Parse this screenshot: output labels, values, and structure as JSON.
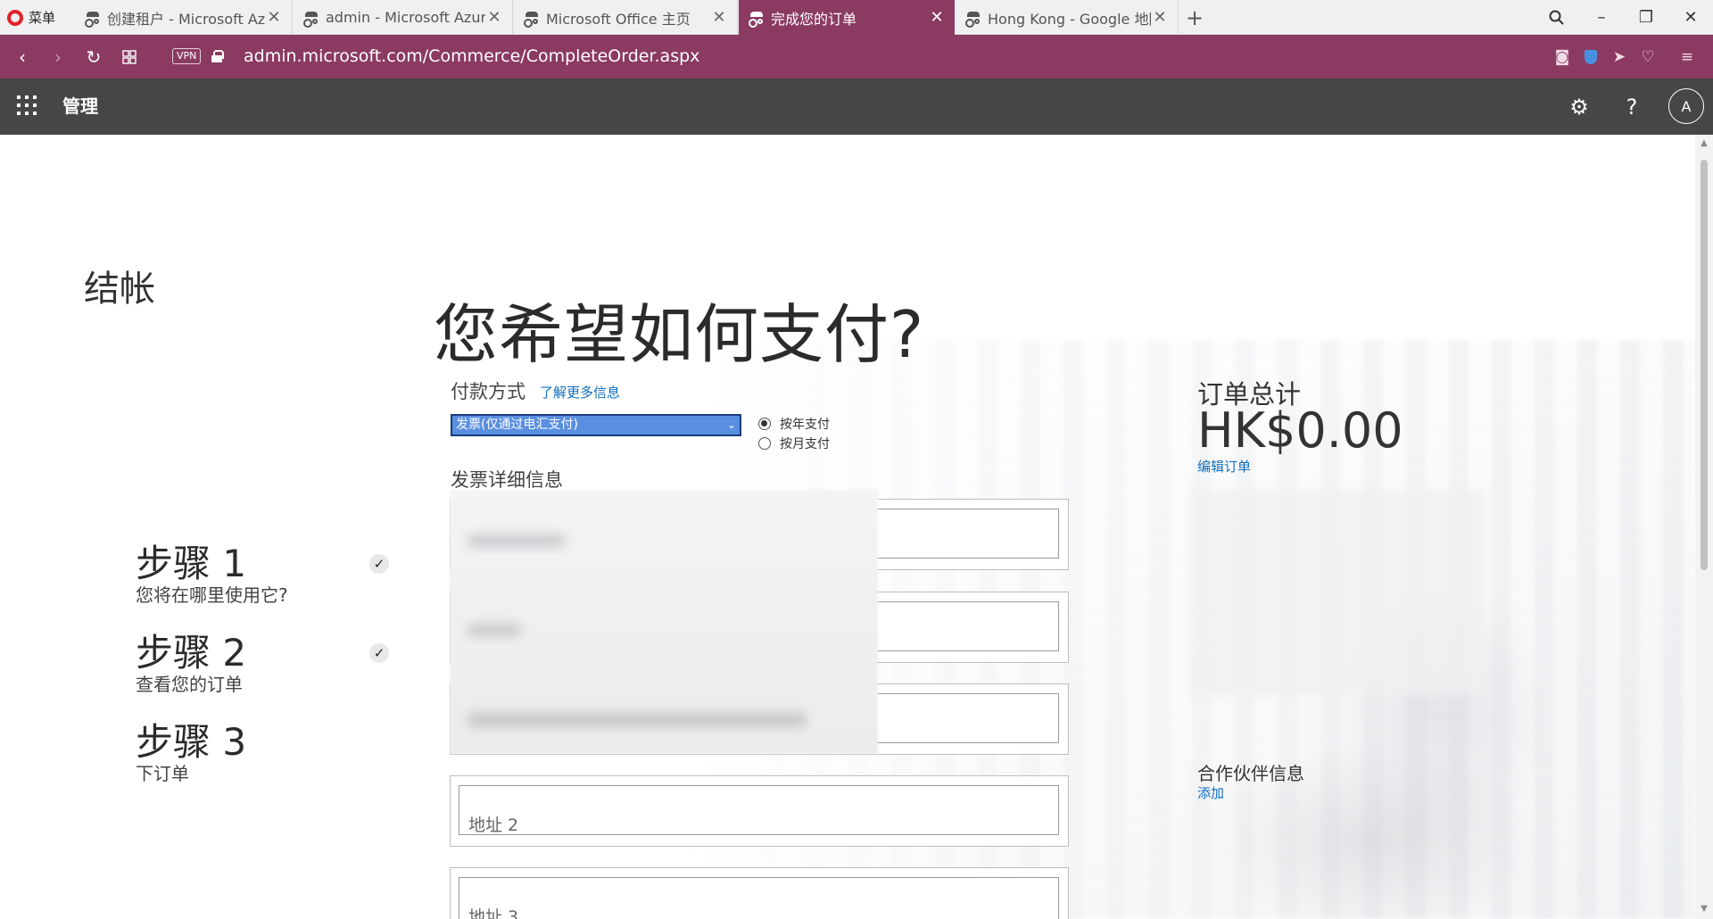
{
  "browser": {
    "menu_label": "菜单",
    "tabs": [
      {
        "title": "创建租户 - Microsoft Azure",
        "active": false
      },
      {
        "title": "admin - Microsoft Azure",
        "active": false
      },
      {
        "title": "Microsoft Office 主页",
        "active": false
      },
      {
        "title": "完成您的订单",
        "active": true
      },
      {
        "title": "Hong Kong - Google 地图",
        "active": false
      }
    ],
    "vpn_label": "VPN",
    "url": "admin.microsoft.com/Commerce/CompleteOrder.aspx",
    "accent_color": "#8b3a62"
  },
  "header": {
    "title": "管理",
    "avatar_initial": "A",
    "background_color": "#464646"
  },
  "page": {
    "checkout_title": "结帐",
    "heading": "您希望如何支付?",
    "steps": [
      {
        "title": "步骤 1",
        "subtitle": "您将在哪里使用它?",
        "completed": true
      },
      {
        "title": "步骤 2",
        "subtitle": "查看您的订单",
        "completed": true
      },
      {
        "title": "步骤 3",
        "subtitle": "下订单",
        "completed": false
      }
    ],
    "payment": {
      "label": "付款方式",
      "learn_more": "了解更多信息",
      "selected_method": "发票(仅通过电汇支付)",
      "frequency_options": [
        {
          "label": "按年支付",
          "selected": true
        },
        {
          "label": "按月支付",
          "selected": false
        }
      ]
    },
    "invoice": {
      "label": "发票详细信息",
      "address2_placeholder": "地址 2",
      "address3_placeholder": "地址 3"
    },
    "order": {
      "total_label": "订单总计",
      "total_value": "HK$0.00",
      "edit_link": "编辑订单"
    },
    "partner": {
      "label": "合作伙伴信息",
      "add_link": "添加"
    }
  }
}
